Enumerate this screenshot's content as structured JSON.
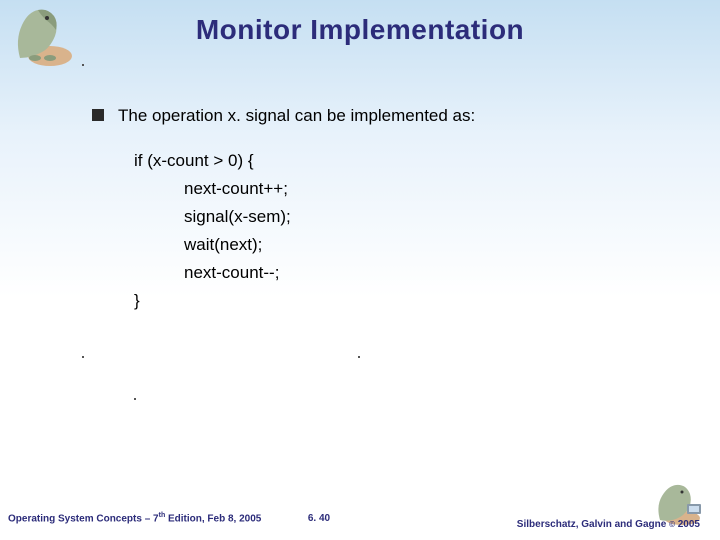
{
  "title": "Monitor Implementation",
  "bullet": {
    "pre": "The operation ",
    "op": "x. signal",
    "post": " can be implemented as:"
  },
  "code": {
    "l1": "if (x-count > 0) {",
    "l2": "next-count++;",
    "l3": "signal(x-sem);",
    "l4": "wait(next);",
    "l5": "next-count--;",
    "l6": "}"
  },
  "footer": {
    "left_pre": "Operating System Concepts – 7",
    "left_sup": "th",
    "left_post": " Edition, Feb 8, 2005",
    "center": "6. 40",
    "right_pre": "Silberschatz, Galvin and Gagne ",
    "right_copy": "©",
    "right_year": " 2005"
  }
}
